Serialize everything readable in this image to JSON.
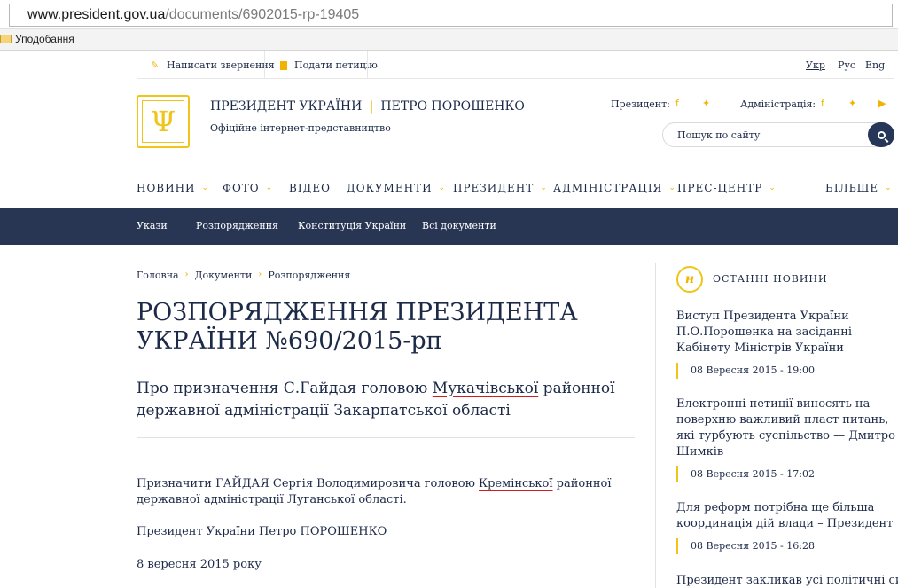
{
  "browser": {
    "url_host": "www.president.gov.ua",
    "url_path": "/documents/6902015-rp-19405",
    "bookmark_folder": "Уподобання"
  },
  "top_strip": {
    "appeal": "Написати звернення",
    "petition": "Подати петицію",
    "langs": [
      "Укр",
      "Рус",
      "Eng"
    ]
  },
  "header": {
    "title_left": "ПРЕЗИДЕНТ УКРАЇНИ",
    "title_sep": "|",
    "title_right": "ПЕТРО ПОРОШЕНКО",
    "subtitle": "Офіційне інтернет-представництво",
    "social_president_label": "Президент:",
    "social_admin_label": "Адміністрація:",
    "search_placeholder": "Пошук по сайту",
    "icons": {
      "facebook": "facebook-icon",
      "twitter": "twitter-icon",
      "youtube": "youtube-icon",
      "search": "search-icon"
    }
  },
  "main_nav": [
    {
      "label": "НОВИНИ",
      "dropdown": true
    },
    {
      "label": "ФОТО",
      "dropdown": true
    },
    {
      "label": "ВІДЕО",
      "dropdown": false
    },
    {
      "label": "ДОКУМЕНТИ",
      "dropdown": true
    },
    {
      "label": "ПРЕЗИДЕНТ",
      "dropdown": true
    },
    {
      "label": "АДМІНІСТРАЦІЯ",
      "dropdown": true
    },
    {
      "label": "ПРЕС-ЦЕНТР",
      "dropdown": true
    },
    {
      "label": "БІЛЬШЕ",
      "dropdown": true
    }
  ],
  "sub_nav": [
    "Укази",
    "Розпорядження",
    "Конституція України",
    "Всі документи"
  ],
  "breadcrumb": [
    "Головна",
    "Документи",
    "Розпорядження"
  ],
  "document": {
    "title": "РОЗПОРЯДЖЕННЯ ПРЕЗИДЕНТА УКРАЇНИ №690/2015-рп",
    "subtitle_pre": "Про призначення С.Гайдая головою ",
    "subtitle_mark": "Мукачівської",
    "subtitle_post": " районної державної адміністрації Закарпатської області",
    "body_pre": "Призначити ГАЙДАЯ Сергія Володимировича головою ",
    "body_mark": "Кремінської",
    "body_post": " районної державної адміністрації Луганської області.",
    "signature": "Президент України Петро ПОРОШЕНКО",
    "date": "8 вересня 2015 року"
  },
  "sidebar": {
    "badge": "н",
    "heading": "ОСТАННІ НОВИНИ",
    "news": [
      {
        "title": "Виступ Президента України П.О.Порошенка на засіданні Кабінету Міністрів України",
        "date": "08 Вересня 2015 - 19:00"
      },
      {
        "title": "Електронні петиції виносять на поверхню важливий пласт питань, які турбують суспільство — Дмитро Шимків",
        "date": "08 Вересня 2015 - 17:02"
      },
      {
        "title": "Для реформ потрібна ще більша координація дій влади – Президент",
        "date": "08 Вересня 2015 - 16:28"
      },
      {
        "title": "Президент закликав усі політичні сили",
        "date": ""
      }
    ]
  },
  "colors": {
    "accent": "#f0b400",
    "navy": "#283654",
    "text": "#1c2a48",
    "mark": "#d01c1c"
  }
}
